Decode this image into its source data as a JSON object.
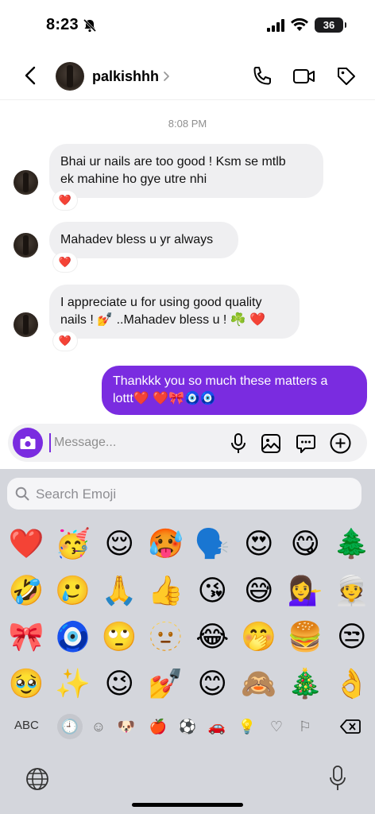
{
  "status_bar": {
    "time": "8:23",
    "battery": "36"
  },
  "header": {
    "username": "palkishhh"
  },
  "thread": {
    "timestamp": "8:08 PM",
    "incoming": [
      {
        "line1": "Bhai ur nails are too good ! Ksm se mtlb",
        "line2": "ek mahine ho gye utre nhi",
        "reaction": "❤️"
      },
      {
        "line1": "Mahadev bless u yr always",
        "line2": "",
        "reaction": "❤️"
      },
      {
        "line1": "I appreciate u for using good quality",
        "line2": "nails ! 💅 ..Mahadev bless u ! ☘️ ❤️",
        "reaction": "❤️"
      }
    ],
    "outgoing": {
      "line1": "Thankkk you so much these matters a",
      "line2": "lottt❤️ ❤️🎀🧿🧿"
    }
  },
  "composer": {
    "placeholder": "Message..."
  },
  "keyboard": {
    "search_placeholder": "Search Emoji",
    "emojis": [
      "❤️",
      "🥳",
      "😌",
      "🥵",
      "🗣️",
      "😍",
      "😋",
      "🌲",
      "🤣",
      "🥲",
      "🙏",
      "👍",
      "😘",
      "😅",
      "💁‍♀️",
      "👳",
      "🎀",
      "🧿",
      "🙄",
      "🫥",
      "😂",
      "🤭",
      "🍔",
      "😒",
      "🥹",
      "✨",
      "😉",
      "💅",
      "😊",
      "🙈",
      "🎄",
      "👌"
    ],
    "abc_label": "ABC",
    "categories": [
      "🕘",
      "☺",
      "🐶",
      "🍎",
      "⚽",
      "🚗",
      "💡",
      "♡",
      "⚐"
    ]
  },
  "colors": {
    "accent": "#7a2ce0",
    "bubble_in": "#efeff1",
    "keyboard_bg": "#d4d6dc"
  }
}
